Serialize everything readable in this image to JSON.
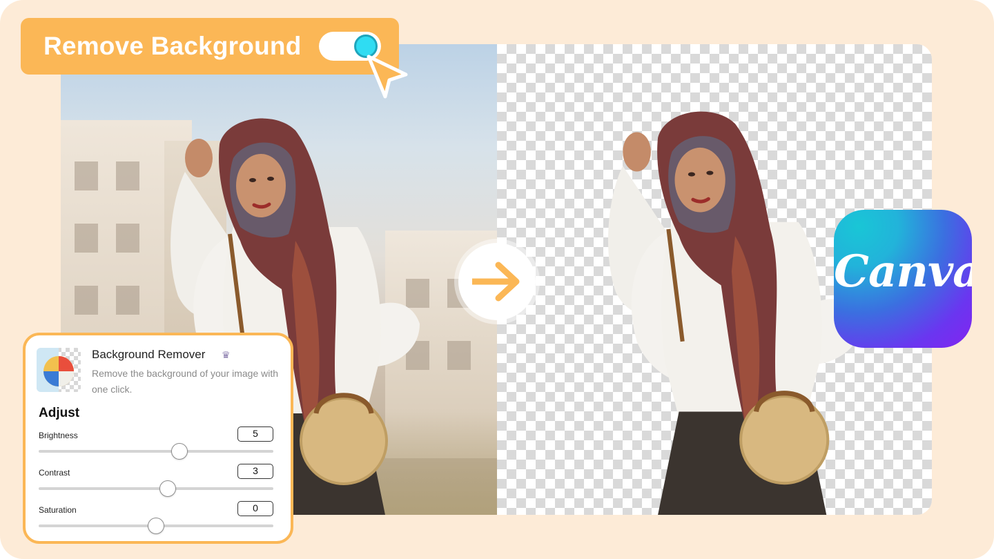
{
  "badge": {
    "title": "Remove Background",
    "toggle_on": true,
    "accent_color": "#fbb756",
    "knob_color": "#2fdcf2"
  },
  "transition": {
    "icon": "arrow-right-icon"
  },
  "brand": {
    "logo_text": "Canva"
  },
  "panel": {
    "tool_title": "Background Remover",
    "premium_icon": "crown-icon",
    "description": "Remove the background of your image with one click.",
    "adjust_heading": "Adjust",
    "sliders": [
      {
        "label": "Brightness",
        "value": "5",
        "level": 0.6
      },
      {
        "label": "Contrast",
        "value": "3",
        "level": 0.55
      },
      {
        "label": "Saturation",
        "value": "0",
        "level": 0.5
      }
    ]
  }
}
